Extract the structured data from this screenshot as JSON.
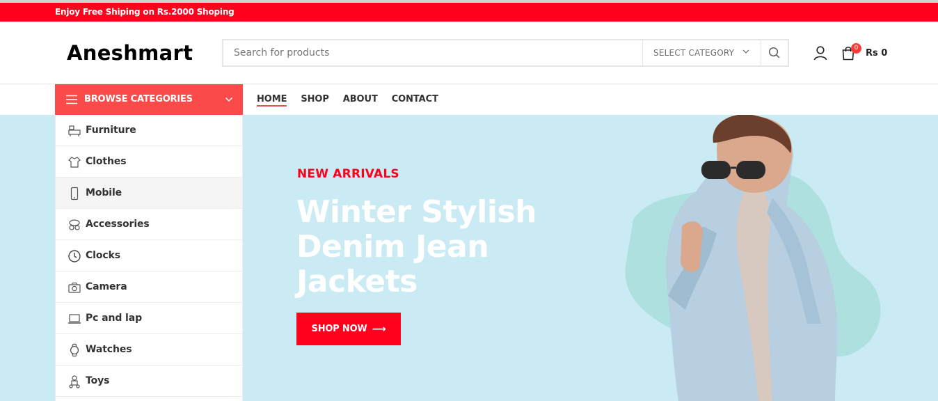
{
  "promo": {
    "text": "Enjoy Free Shiping on Rs.2000 Shoping"
  },
  "header": {
    "logo": "Aneshmart",
    "search": {
      "placeholder": "Search for products",
      "category_label": "SELECT CATEGORY"
    },
    "cart": {
      "count": "0",
      "total": "Rs 0"
    }
  },
  "nav": {
    "browse_label": "BROWSE CATEGORIES",
    "items": [
      {
        "label": "HOME",
        "active": true
      },
      {
        "label": "SHOP"
      },
      {
        "label": "ABOUT"
      },
      {
        "label": "CONTACT"
      }
    ]
  },
  "categories": [
    {
      "label": "Furniture",
      "icon": "furniture-icon"
    },
    {
      "label": "Clothes",
      "icon": "clothes-icon"
    },
    {
      "label": "Mobile",
      "icon": "mobile-icon"
    },
    {
      "label": "Accessories",
      "icon": "accessories-icon"
    },
    {
      "label": "Clocks",
      "icon": "clock-icon"
    },
    {
      "label": "Camera",
      "icon": "camera-icon"
    },
    {
      "label": "Pc and lap",
      "icon": "laptop-icon"
    },
    {
      "label": "Watches",
      "icon": "watch-icon"
    },
    {
      "label": "Toys",
      "icon": "toys-icon"
    }
  ],
  "hero": {
    "kicker": "NEW ARRIVALS",
    "title_lines": [
      "Winter Stylish",
      "Denim Jean",
      "Jackets"
    ],
    "button_label": "SHOP NOW",
    "button_arrow": "⟶"
  },
  "colors": {
    "promo_bar": "#ff001d",
    "browse_bg": "#fa4a4a",
    "hero_bg": "#cbebf4",
    "accent": "#ff001d"
  }
}
